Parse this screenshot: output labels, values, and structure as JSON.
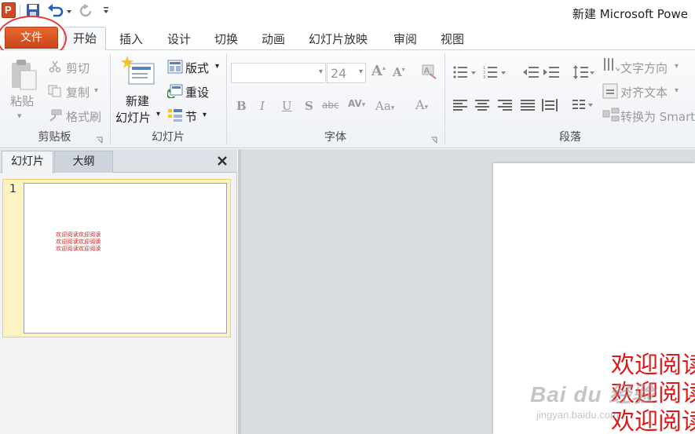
{
  "window": {
    "title": "新建 Microsoft Powe"
  },
  "app": {
    "logo_letter": "P"
  },
  "quick_access": [
    "save",
    "undo",
    "redo",
    "customize"
  ],
  "tabs": {
    "file": "文件",
    "items": [
      "开始",
      "插入",
      "设计",
      "切换",
      "动画",
      "幻灯片放映",
      "审阅",
      "视图"
    ]
  },
  "ribbon": {
    "clipboard": {
      "label": "剪贴板",
      "paste": "粘贴",
      "cut": "剪切",
      "copy": "复制",
      "format_painter": "格式刷"
    },
    "slides": {
      "label": "幻灯片",
      "new_slide_line1": "新建",
      "new_slide_line2": "幻灯片",
      "layout": "版式",
      "reset": "重设",
      "section": "节"
    },
    "font": {
      "label": "字体",
      "font_name": "",
      "font_size": "24"
    },
    "paragraph": {
      "label": "段落",
      "text_direction": "文字方向",
      "align_text": "对齐文本",
      "smartart": "转换为 Smart"
    }
  },
  "left_panel": {
    "tab_slides": "幻灯片",
    "tab_outline": "大纲",
    "slide_number": "1"
  },
  "slide": {
    "text_color": "#e01818",
    "thumb_lines": [
      "欢迎阅读欢迎阅读",
      "欢迎阅读欢迎阅读",
      "欢迎阅读欢迎阅读"
    ],
    "lines": [
      "欢迎阅读",
      "欢迎阅读",
      "欢迎阅读"
    ]
  },
  "watermark": {
    "main": "Bai du 经验",
    "sub": "jingyan.baidu.com"
  },
  "colors": {
    "file_tab": "#d9541e",
    "annotation_circle": "#e23b3b"
  }
}
